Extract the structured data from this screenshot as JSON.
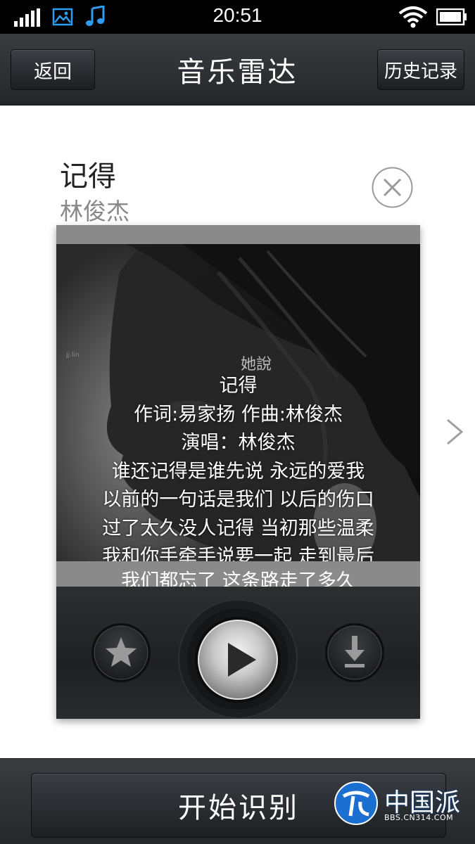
{
  "status_bar": {
    "time": "20:51",
    "icons": [
      "signal-icon",
      "gallery-icon",
      "music-note-icon",
      "wifi-icon",
      "battery-icon"
    ],
    "accent_color": "#2d9cf0"
  },
  "header": {
    "back_label": "返回",
    "title": "音乐雷达",
    "history_label": "历史记录"
  },
  "song": {
    "title": "记得",
    "artist": "林俊杰"
  },
  "cover": {
    "overlay_text": "她說",
    "small_text": "jj.lin"
  },
  "lyrics": {
    "lines": [
      "记得",
      "作词:易家扬 作曲:林俊杰",
      "演唱：林俊杰",
      "谁还记得是谁先说 永远的爱我",
      "以前的一句话是我们 以后的伤口",
      "过了太久没人记得 当初那些温柔",
      "我和你手牵手说要一起 走到最后"
    ],
    "partial_line": "我们都忘了 这条路走了多久"
  },
  "player": {
    "favorite_icon": "star-icon",
    "play_icon": "play-icon",
    "download_icon": "download-icon"
  },
  "footer": {
    "start_label": "开始识别"
  },
  "watermark": {
    "text": "中国派",
    "url": "BBS.CN314.COM"
  }
}
